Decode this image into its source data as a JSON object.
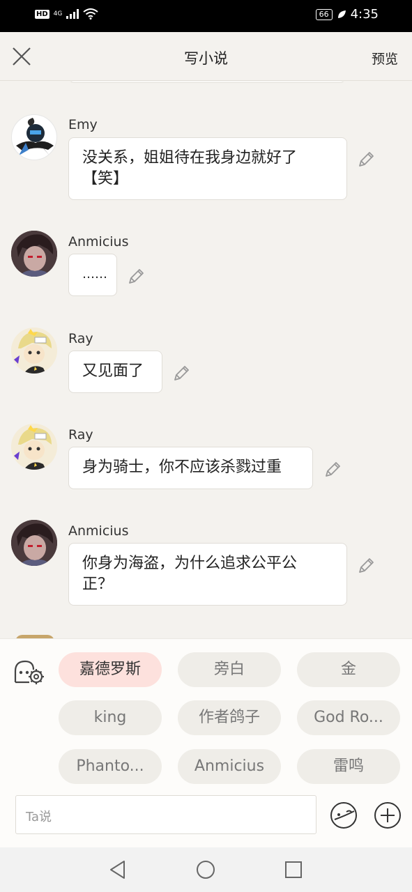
{
  "status_bar": {
    "hd": "HD",
    "network": "4G",
    "battery": "66",
    "time": "4:35"
  },
  "header": {
    "title": "写小说",
    "preview_label": "预览"
  },
  "messages": [
    {
      "name": "Emy",
      "text": "没关系，姐姐待在我身边就好了【笑】",
      "line1": "没关系，姐姐待在我身边就好了",
      "line2": "【笑】"
    },
    {
      "name": "Anmicius",
      "text": "……"
    },
    {
      "name": "Ray",
      "text": "又见面了"
    },
    {
      "name": "Ray",
      "text": "身为骑士，你不应该杀戮过重"
    },
    {
      "name": "Anmicius",
      "text": "你身为海盗，为什么追求公平公正？",
      "line1": "你身为海盗，为什么追求公平公",
      "line2": "正？"
    }
  ],
  "roles": [
    "嘉德罗斯",
    "旁白",
    "金",
    "king",
    "作者鸽子",
    "God Ro...",
    "Phanto...",
    "Anmicius",
    "雷鸣"
  ],
  "selected_role": "嘉德罗斯",
  "input": {
    "placeholder": "Ta说"
  },
  "colors": {
    "active_chip": "#fde1dd",
    "chip": "#efede8",
    "background": "#f4f2ee"
  }
}
